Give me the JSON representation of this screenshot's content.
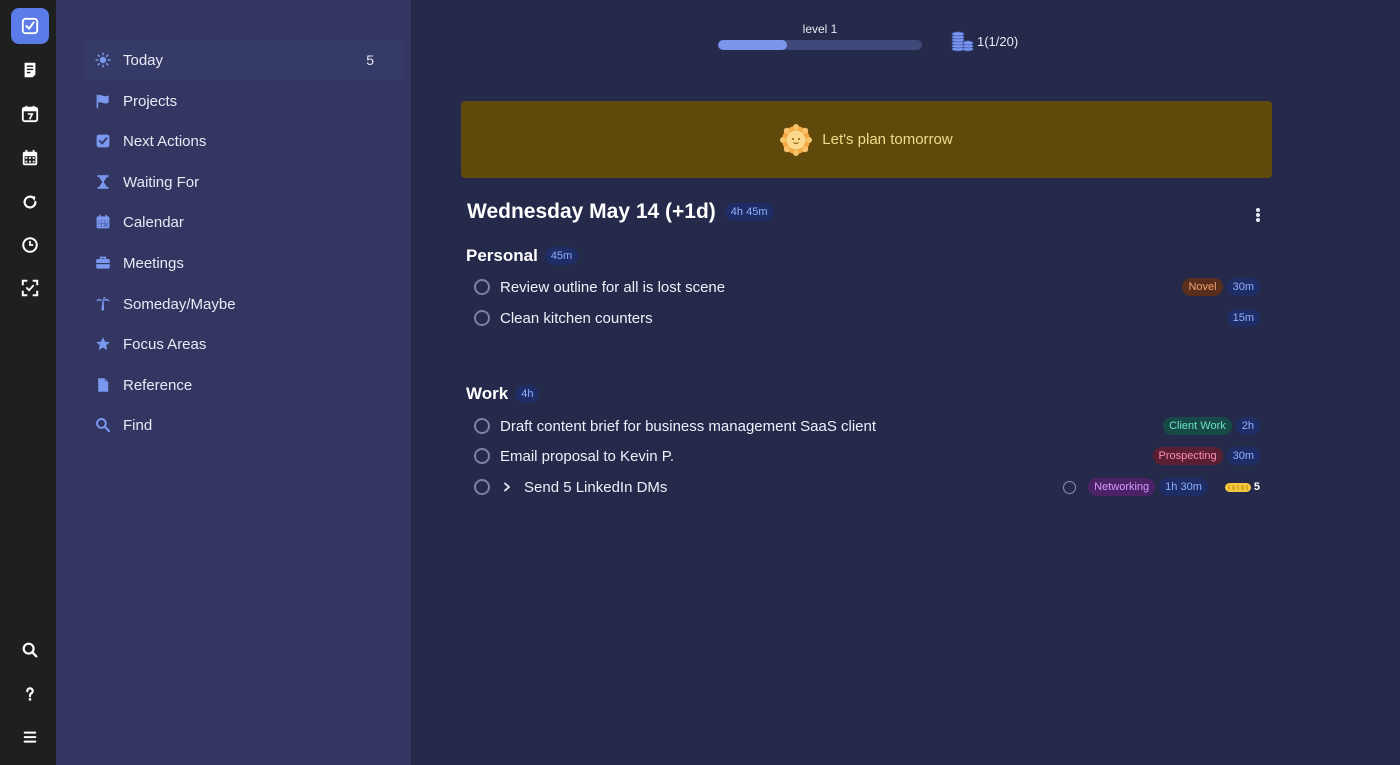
{
  "rail": {
    "top": [
      "tasks",
      "notes",
      "calendar-day",
      "calendar-month",
      "refresh",
      "clock",
      "focus"
    ],
    "bottom": [
      "search",
      "help",
      "menu"
    ]
  },
  "sidebar": {
    "items": [
      {
        "label": "Today",
        "count": "5",
        "icon": "sun-icon"
      },
      {
        "label": "Projects",
        "icon": "flag-icon"
      },
      {
        "label": "Next Actions",
        "icon": "checkbox-icon"
      },
      {
        "label": "Waiting For",
        "icon": "hourglass-icon"
      },
      {
        "label": "Calendar",
        "icon": "calendar-icon"
      },
      {
        "label": "Meetings",
        "icon": "briefcase-icon"
      },
      {
        "label": "Someday/Maybe",
        "icon": "palm-tree-icon"
      },
      {
        "label": "Focus Areas",
        "icon": "star-icon"
      },
      {
        "label": "Reference",
        "icon": "document-icon"
      },
      {
        "label": "Find",
        "icon": "search-icon"
      }
    ]
  },
  "header": {
    "level_label": "level 1",
    "level_progress": 0.34,
    "coins": "1(1/20)"
  },
  "banner": {
    "text": "Let's plan tomorrow"
  },
  "day": {
    "title": "Wednesday May 14 (+1d)",
    "total": "4h 45m"
  },
  "sections": {
    "personal": {
      "title": "Personal",
      "duration": "45m",
      "tasks": [
        {
          "title": "Review outline for all is lost scene",
          "tag": "Novel",
          "duration": "30m"
        },
        {
          "title": "Clean kitchen counters",
          "duration": "15m"
        }
      ]
    },
    "work": {
      "title": "Work",
      "duration": "4h",
      "tasks": [
        {
          "title": "Draft content brief for business management SaaS client",
          "tag": "Client Work",
          "duration": "2h"
        },
        {
          "title": "Email proposal to Kevin P.",
          "tag": "Prospecting",
          "duration": "30m"
        },
        {
          "title": "Send 5 LinkedIn DMs",
          "tag": "Networking",
          "duration": "1h 30m",
          "energy": "5"
        }
      ]
    }
  },
  "colors": {
    "accent": "#5b7be8",
    "banner": "#5f4a0c",
    "sidebar": "#323661",
    "main": "#252a4a"
  }
}
